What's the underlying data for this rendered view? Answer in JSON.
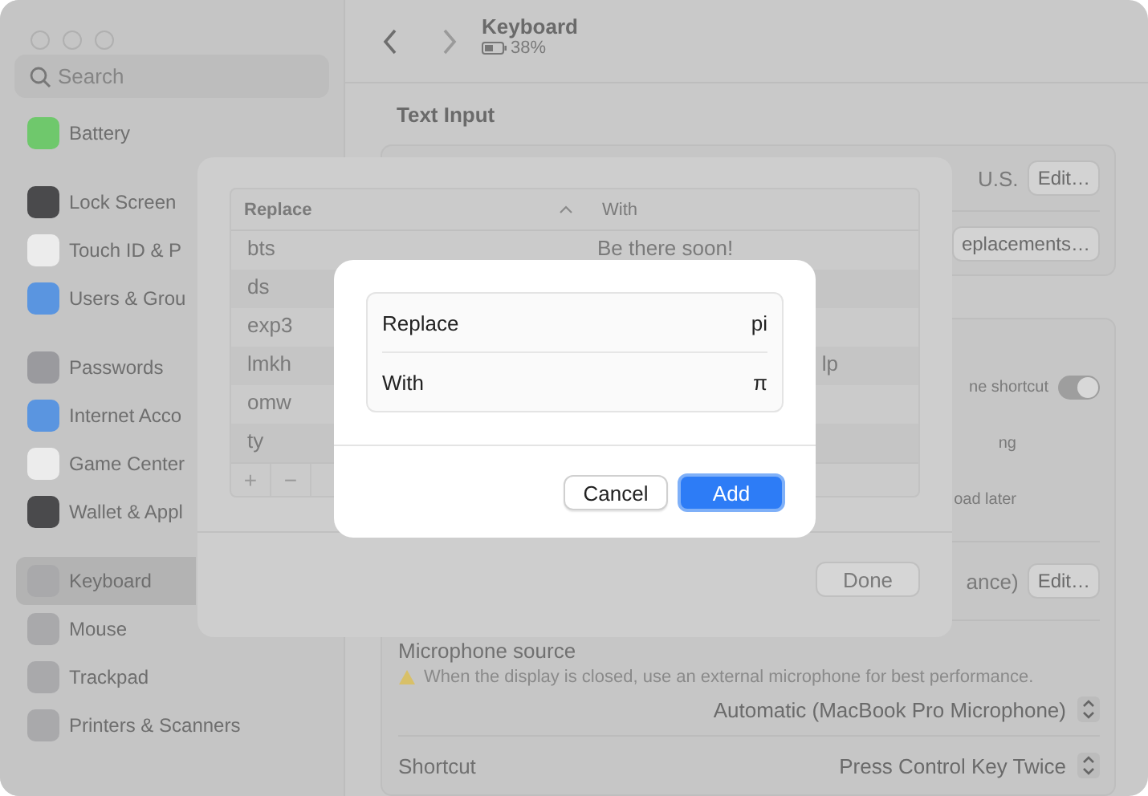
{
  "window": {
    "title": "Keyboard",
    "subtitle": "38%"
  },
  "sidebar": {
    "search": {
      "placeholder": "Search"
    },
    "groups": [
      [
        {
          "label": "Battery",
          "color": "#6fc86c",
          "selected": false
        }
      ],
      [
        {
          "label": "Lock Screen",
          "color": "#4a4a4c",
          "selected": false
        },
        {
          "label": "Touch ID & P",
          "color": "#ececec",
          "selected": false
        },
        {
          "label": "Users & Grou",
          "color": "#5a95e0",
          "selected": false
        }
      ],
      [
        {
          "label": "Passwords",
          "color": "#9a9a9e",
          "selected": false
        },
        {
          "label": "Internet Acco",
          "color": "#5a95e0",
          "selected": false
        },
        {
          "label": "Game Center",
          "color": "#ececec",
          "selected": false
        },
        {
          "label": "Wallet & Appl",
          "color": "#4a4a4c",
          "selected": false
        }
      ],
      [
        {
          "label": "Keyboard",
          "color": "#a9a9ab",
          "selected": true
        },
        {
          "label": "Mouse",
          "color": "#a9a9ab",
          "selected": false
        },
        {
          "label": "Trackpad",
          "color": "#a9a9ab",
          "selected": false
        },
        {
          "label": "Printers & Scanners",
          "color": "#a9a9ab",
          "selected": false
        }
      ]
    ]
  },
  "section_title": "Text Input",
  "card_1": [
    {
      "kind": "button-row",
      "text": "U.S.",
      "button": "Edit…"
    },
    {
      "kind": "button",
      "button": "eplacements…"
    }
  ],
  "card_2": [
    {
      "kind": "toggle",
      "text": "ne shortcut",
      "on": true
    },
    {
      "kind": "text",
      "text": "ng"
    },
    {
      "kind": "text",
      "text": "oad later"
    },
    {
      "kind": "button-row",
      "text": "ance)",
      "button": "Edit…"
    },
    {
      "kind": "popup-note",
      "label": "Microphone source",
      "note": "When the display is closed, use an external microphone for best performance.",
      "value": "Automatic (MacBook Pro Microphone)"
    },
    {
      "kind": "popup",
      "label": "Shortcut",
      "value": "Press Control Key Twice"
    }
  ],
  "sheet": {
    "columns": [
      "Replace",
      "With"
    ],
    "rows": [
      {
        "replace": "bts",
        "with": "Be there soon!"
      },
      {
        "replace": "ds"
      },
      {
        "replace": "exp3"
      },
      {
        "replace": "lmkh",
        "with": "lp",
        "cut": true
      },
      {
        "replace": "omw"
      },
      {
        "replace": "ty"
      }
    ],
    "add": "+",
    "remove": "−",
    "done": "Done"
  },
  "dialog": {
    "fields": [
      {
        "label": "Replace",
        "value": "pi"
      },
      {
        "label": "With",
        "value": "π"
      }
    ],
    "cancel": "Cancel",
    "add": "Add"
  }
}
